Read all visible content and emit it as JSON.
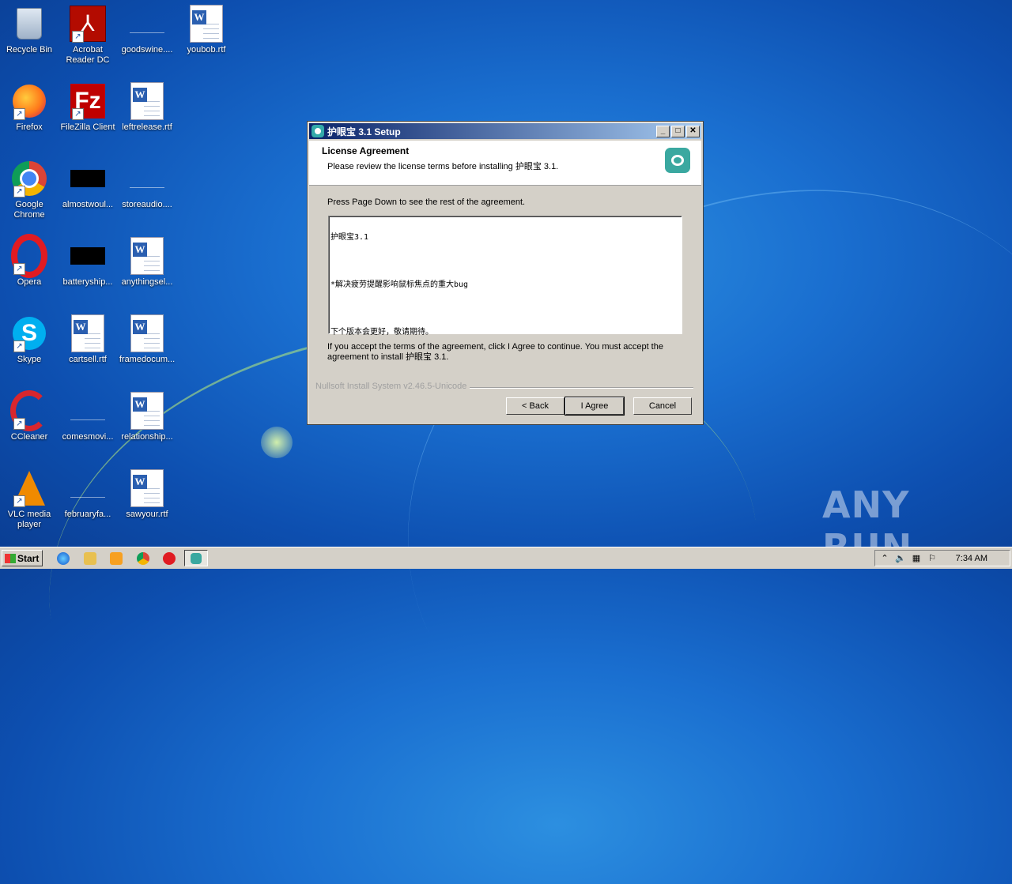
{
  "desktop": {
    "icons": [
      {
        "label": "Recycle Bin",
        "icon": "recycle-bin-icon"
      },
      {
        "label": "Acrobat Reader DC",
        "icon": "acrobat-icon"
      },
      {
        "label": "goodswine....",
        "icon": "blank-file-icon"
      },
      {
        "label": "youbob.rtf",
        "icon": "word-doc-icon"
      },
      {
        "label": "Firefox",
        "icon": "firefox-icon"
      },
      {
        "label": "FileZilla Client",
        "icon": "filezilla-icon"
      },
      {
        "label": "leftrelease.rtf",
        "icon": "word-doc-icon"
      },
      {
        "label": "Google Chrome",
        "icon": "chrome-icon"
      },
      {
        "label": "almostwoul...",
        "icon": "black-file-icon"
      },
      {
        "label": "storeaudio....",
        "icon": "blank-file-icon"
      },
      {
        "label": "Opera",
        "icon": "opera-icon"
      },
      {
        "label": "batteryship...",
        "icon": "black-file-icon"
      },
      {
        "label": "anythingsel...",
        "icon": "word-doc-icon"
      },
      {
        "label": "Skype",
        "icon": "skype-icon"
      },
      {
        "label": "cartsell.rtf",
        "icon": "word-doc-icon"
      },
      {
        "label": "framedocum...",
        "icon": "word-doc-icon"
      },
      {
        "label": "CCleaner",
        "icon": "ccleaner-icon"
      },
      {
        "label": "comesmovi...",
        "icon": "blank-file-icon"
      },
      {
        "label": "relationship...",
        "icon": "word-doc-icon"
      },
      {
        "label": "VLC media player",
        "icon": "vlc-icon"
      },
      {
        "label": "februaryfa...",
        "icon": "blank-file-icon"
      },
      {
        "label": "sawyour.rtf",
        "icon": "word-doc-icon"
      }
    ],
    "watermark": "ANY RUN"
  },
  "dialog": {
    "title": "护眼宝 3.1 Setup",
    "header_title": "License Agreement",
    "header_subtitle": "Please review the license terms before installing 护眼宝 3.1.",
    "instruction": "Press Page Down to see the rest of the agreement.",
    "license_lines": [
      "护眼宝3.1",
      "*解决疲劳提醒影响鼠标焦点的重大bug",
      "下个版本会更好，敬请期待。"
    ],
    "accept_text": "If you accept the terms of the agreement, click I Agree to continue. You must accept the agreement to install 护眼宝 3.1.",
    "branding": "Nullsoft Install System v2.46.5-Unicode",
    "back_label": "< Back",
    "agree_label": "I Agree",
    "cancel_label": "Cancel",
    "minimize": "_",
    "maximize": "□",
    "close": "✕"
  },
  "taskbar": {
    "start_label": "Start",
    "clock": "7:34 AM"
  }
}
